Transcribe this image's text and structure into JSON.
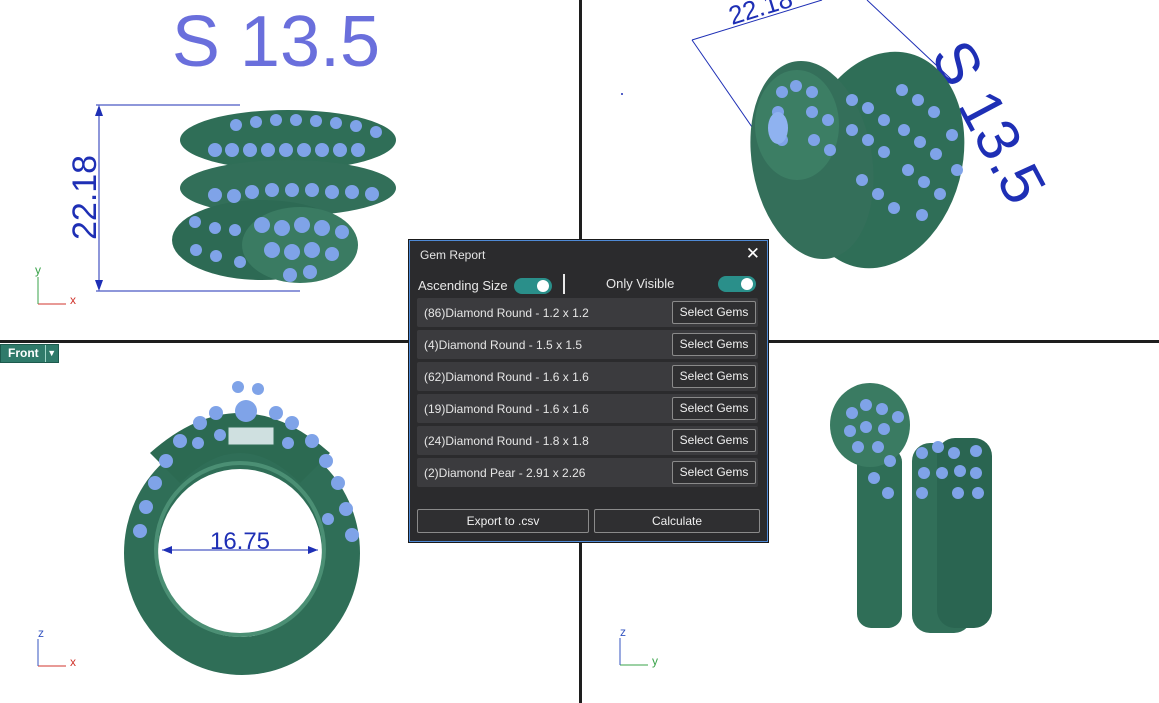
{
  "dialog": {
    "title": "Gem Report",
    "ascending_label": "Ascending Size",
    "ascending_on": true,
    "visible_label": "Only Visible",
    "visible_on": true,
    "rows": [
      {
        "label": "(86)Diamond Round - 1.2 x 1.2",
        "button": "Select Gems"
      },
      {
        "label": "(4)Diamond Round - 1.5 x 1.5",
        "button": "Select Gems"
      },
      {
        "label": "(62)Diamond Round - 1.6 x 1.6",
        "button": "Select Gems"
      },
      {
        "label": "(19)Diamond Round - 1.6 x 1.6",
        "button": "Select Gems"
      },
      {
        "label": "(24)Diamond Round - 1.8 x 1.8",
        "button": "Select Gems"
      },
      {
        "label": "(2)Diamond Pear - 2.91 x 2.26",
        "button": "Select Gems"
      }
    ],
    "export_label": "Export to .csv",
    "calculate_label": "Calculate"
  },
  "viewports": {
    "active_tab": "Front",
    "top_left": {
      "size_text": "S 13.5",
      "dimension": "22.18",
      "axis_v": "y",
      "axis_h": "x"
    },
    "top_right": {
      "size_text": "S 13.5",
      "dimension": "22.18"
    },
    "bottom_left": {
      "dimension": "16.75",
      "axis_v": "z",
      "axis_h": "x"
    },
    "bottom_right": {
      "axis_v": "z",
      "axis_h": "y"
    }
  },
  "colors": {
    "metal": "#2f6e57",
    "gem": "#7fa3e8",
    "annotation_blue": "#1e2fb5",
    "size_label": "#5b5fd6",
    "accent_toggle": "#2a8f8a"
  }
}
